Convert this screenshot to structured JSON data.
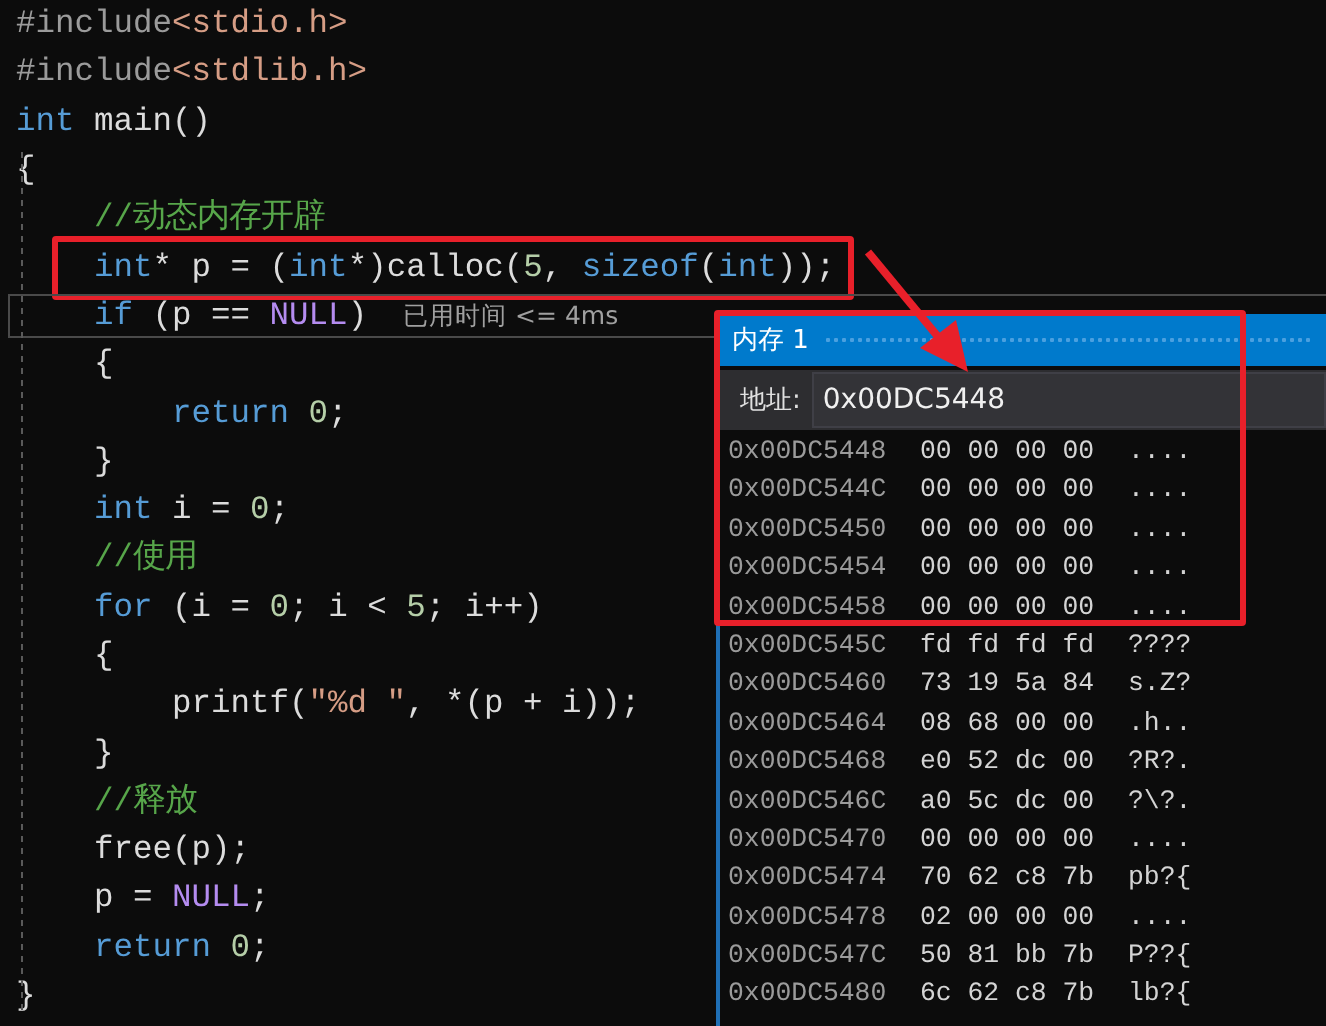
{
  "editor": {
    "code_lines": [
      {
        "boxed": false,
        "current": false,
        "tokens": [
          {
            "kind": "preprocessor",
            "text": "#include"
          },
          {
            "kind": "string",
            "text": "<stdio.h>"
          }
        ]
      },
      {
        "boxed": false,
        "current": false,
        "tokens": [
          {
            "kind": "preprocessor",
            "text": "#include"
          },
          {
            "kind": "string",
            "text": "<stdlib.h>"
          }
        ]
      },
      {
        "boxed": false,
        "current": false,
        "tokens": [
          {
            "kind": "keyword",
            "text": "int"
          },
          {
            "kind": "plain",
            "text": " main()"
          }
        ]
      },
      {
        "boxed": false,
        "current": false,
        "tokens": [
          {
            "kind": "plain",
            "text": "{"
          }
        ]
      },
      {
        "boxed": false,
        "current": false,
        "tokens": [
          {
            "kind": "comment",
            "text": "    //动态内存开辟"
          }
        ]
      },
      {
        "boxed": true,
        "current": false,
        "tokens": [
          {
            "kind": "keyword",
            "text": "    int"
          },
          {
            "kind": "plain",
            "text": "* p = ("
          },
          {
            "kind": "keyword",
            "text": "int"
          },
          {
            "kind": "plain",
            "text": "*)calloc("
          },
          {
            "kind": "number",
            "text": "5"
          },
          {
            "kind": "plain",
            "text": ", "
          },
          {
            "kind": "keyword",
            "text": "sizeof"
          },
          {
            "kind": "plain",
            "text": "("
          },
          {
            "kind": "keyword",
            "text": "int"
          },
          {
            "kind": "plain",
            "text": "));"
          }
        ]
      },
      {
        "boxed": false,
        "current": true,
        "hint": "已用时间 <= 4ms",
        "tokens": [
          {
            "kind": "keyword",
            "text": "    if"
          },
          {
            "kind": "plain",
            "text": " (p == "
          },
          {
            "kind": "macro",
            "text": "NULL"
          },
          {
            "kind": "plain",
            "text": ")"
          }
        ]
      },
      {
        "boxed": false,
        "current": false,
        "tokens": [
          {
            "kind": "plain",
            "text": "    {"
          }
        ]
      },
      {
        "boxed": false,
        "current": false,
        "tokens": [
          {
            "kind": "keyword",
            "text": "        return "
          },
          {
            "kind": "number",
            "text": "0"
          },
          {
            "kind": "plain",
            "text": ";"
          }
        ]
      },
      {
        "boxed": false,
        "current": false,
        "tokens": [
          {
            "kind": "plain",
            "text": "    }"
          }
        ]
      },
      {
        "boxed": false,
        "current": false,
        "tokens": [
          {
            "kind": "keyword",
            "text": "    int"
          },
          {
            "kind": "plain",
            "text": " i = "
          },
          {
            "kind": "number",
            "text": "0"
          },
          {
            "kind": "plain",
            "text": ";"
          }
        ]
      },
      {
        "boxed": false,
        "current": false,
        "tokens": [
          {
            "kind": "comment",
            "text": "    //使用"
          }
        ]
      },
      {
        "boxed": false,
        "current": false,
        "tokens": [
          {
            "kind": "keyword",
            "text": "    for"
          },
          {
            "kind": "plain",
            "text": " (i = "
          },
          {
            "kind": "number",
            "text": "0"
          },
          {
            "kind": "plain",
            "text": "; i < "
          },
          {
            "kind": "number",
            "text": "5"
          },
          {
            "kind": "plain",
            "text": "; i++)"
          }
        ]
      },
      {
        "boxed": false,
        "current": false,
        "tokens": [
          {
            "kind": "plain",
            "text": "    {"
          }
        ]
      },
      {
        "boxed": false,
        "current": false,
        "tokens": [
          {
            "kind": "plain",
            "text": "        printf("
          },
          {
            "kind": "string",
            "text": "\"%d \""
          },
          {
            "kind": "plain",
            "text": ", *(p + i));"
          }
        ]
      },
      {
        "boxed": false,
        "current": false,
        "tokens": [
          {
            "kind": "plain",
            "text": "    }"
          }
        ]
      },
      {
        "boxed": false,
        "current": false,
        "tokens": [
          {
            "kind": "comment",
            "text": "    //释放"
          }
        ]
      },
      {
        "boxed": false,
        "current": false,
        "tokens": [
          {
            "kind": "plain",
            "text": "    free(p);"
          }
        ]
      },
      {
        "boxed": false,
        "current": false,
        "tokens": [
          {
            "kind": "plain",
            "text": "    p = "
          },
          {
            "kind": "macro",
            "text": "NULL"
          },
          {
            "kind": "plain",
            "text": ";"
          }
        ]
      },
      {
        "boxed": false,
        "current": false,
        "tokens": [
          {
            "kind": "keyword",
            "text": "    return "
          },
          {
            "kind": "number",
            "text": "0"
          },
          {
            "kind": "plain",
            "text": ";"
          }
        ]
      },
      {
        "boxed": false,
        "current": false,
        "tokens": [
          {
            "kind": "plain",
            "text": "}"
          }
        ]
      }
    ]
  },
  "memory_window": {
    "title": "内存 1",
    "boxed": true,
    "address_label": "地址:",
    "address": "0x00DC5448",
    "rows": [
      {
        "address": "0x00DC5448",
        "bytes": "00 00 00 00",
        "ascii": "...."
      },
      {
        "address": "0x00DC544C",
        "bytes": "00 00 00 00",
        "ascii": "...."
      },
      {
        "address": "0x00DC5450",
        "bytes": "00 00 00 00",
        "ascii": "...."
      },
      {
        "address": "0x00DC5454",
        "bytes": "00 00 00 00",
        "ascii": "...."
      },
      {
        "address": "0x00DC5458",
        "bytes": "00 00 00 00",
        "ascii": "...."
      },
      {
        "address": "0x00DC545C",
        "bytes": "fd fd fd fd",
        "ascii": "????"
      },
      {
        "address": "0x00DC5460",
        "bytes": "73 19 5a 84",
        "ascii": "s.Z?"
      },
      {
        "address": "0x00DC5464",
        "bytes": "08 68 00 00",
        "ascii": ".h.."
      },
      {
        "address": "0x00DC5468",
        "bytes": "e0 52 dc 00",
        "ascii": "?R?."
      },
      {
        "address": "0x00DC546C",
        "bytes": "a0 5c dc 00",
        "ascii": "?\\?."
      },
      {
        "address": "0x00DC5470",
        "bytes": "00 00 00 00",
        "ascii": "...."
      },
      {
        "address": "0x00DC5474",
        "bytes": "70 62 c8 7b",
        "ascii": "pb?{"
      },
      {
        "address": "0x00DC5478",
        "bytes": "02 00 00 00",
        "ascii": "...."
      },
      {
        "address": "0x00DC547C",
        "bytes": "50 81 bb 7b",
        "ascii": "P??{"
      },
      {
        "address": "0x00DC5480",
        "bytes": "6c 62 c8 7b",
        "ascii": "lb?{"
      }
    ]
  }
}
